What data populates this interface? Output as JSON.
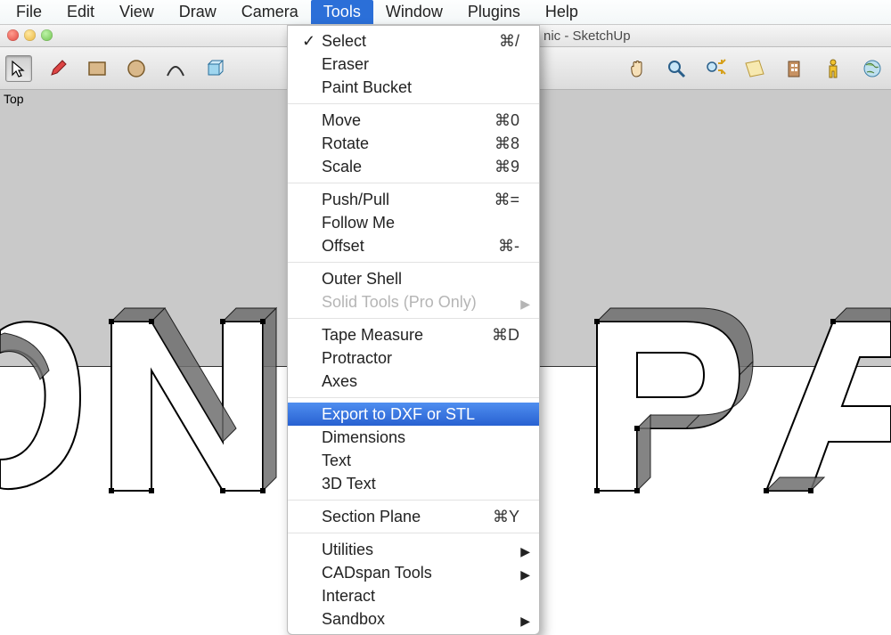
{
  "menubar": {
    "items": [
      {
        "label": "File"
      },
      {
        "label": "Edit"
      },
      {
        "label": "View"
      },
      {
        "label": "Draw"
      },
      {
        "label": "Camera"
      },
      {
        "label": "Tools",
        "active": true
      },
      {
        "label": "Window"
      },
      {
        "label": "Plugins"
      },
      {
        "label": "Help"
      }
    ]
  },
  "window": {
    "title_suffix": "nic - SketchUp"
  },
  "viewport": {
    "label": "Top"
  },
  "toolbar": {
    "icons": [
      "select",
      "pencil",
      "rectangle",
      "circle",
      "arc",
      "rotate",
      "move",
      "pushpull",
      "pan",
      "zoom",
      "zoom-extents",
      "orbit",
      "building",
      "person",
      "globe"
    ]
  },
  "dropdown": {
    "groups": [
      [
        {
          "label": "Select",
          "shortcut": "⌘/",
          "checked": true
        },
        {
          "label": "Eraser"
        },
        {
          "label": "Paint Bucket"
        }
      ],
      [
        {
          "label": "Move",
          "shortcut": "⌘0"
        },
        {
          "label": "Rotate",
          "shortcut": "⌘8"
        },
        {
          "label": "Scale",
          "shortcut": "⌘9"
        }
      ],
      [
        {
          "label": "Push/Pull",
          "shortcut": "⌘="
        },
        {
          "label": "Follow Me"
        },
        {
          "label": "Offset",
          "shortcut": "⌘-"
        }
      ],
      [
        {
          "label": "Outer Shell"
        },
        {
          "label": "Solid Tools (Pro Only)",
          "disabled": true,
          "submenu": true
        }
      ],
      [
        {
          "label": "Tape Measure",
          "shortcut": "⌘D"
        },
        {
          "label": "Protractor"
        },
        {
          "label": "Axes"
        }
      ],
      [
        {
          "label": "Export to DXF or STL",
          "highlight": true
        },
        {
          "label": "Dimensions"
        },
        {
          "label": "Text"
        },
        {
          "label": "3D Text"
        }
      ],
      [
        {
          "label": "Section Plane",
          "shortcut": "⌘Y"
        }
      ],
      [
        {
          "label": "Utilities",
          "submenu": true
        },
        {
          "label": "CADspan Tools",
          "submenu": true
        },
        {
          "label": "Interact"
        },
        {
          "label": "Sandbox",
          "submenu": true
        }
      ]
    ]
  }
}
